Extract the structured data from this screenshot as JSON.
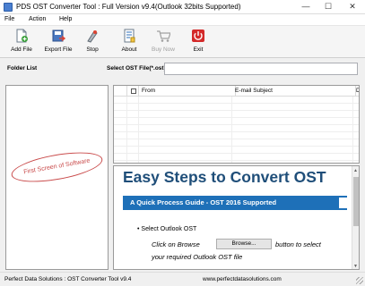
{
  "window": {
    "title": "PDS OST Converter Tool : Full Version v9.4(Outlook 32bits Supported)",
    "minimize_glyph": "—",
    "maximize_glyph": "☐",
    "close_glyph": "✕"
  },
  "menu": {
    "items": [
      "File",
      "Action",
      "Help"
    ]
  },
  "toolbar": {
    "buttons": [
      {
        "label": "Add File",
        "icon": "add-file-icon",
        "enabled": true
      },
      {
        "label": "Export File",
        "icon": "export-file-icon",
        "enabled": true
      },
      {
        "label": "Stop",
        "icon": "stop-icon",
        "enabled": true
      },
      {
        "label": "About",
        "icon": "about-icon",
        "enabled": true
      },
      {
        "label": "Buy Now",
        "icon": "cart-icon",
        "enabled": false
      },
      {
        "label": "Exit",
        "icon": "power-icon",
        "enabled": true
      }
    ]
  },
  "labels": {
    "folder_list": "Folder List",
    "select_ost": "Select OST File(*.ost) :",
    "select_ost_value": ""
  },
  "folder_pane": {
    "stamp_text": "First Screen of Software"
  },
  "mail_grid": {
    "columns": [
      "",
      "",
      "From",
      "E-mail Subject",
      "D"
    ]
  },
  "preview": {
    "heading": "Easy Steps to Convert OST",
    "band_text": "A Quick Process Guide - OST 2016 Supported",
    "bullet": "Select Outlook OST",
    "line1_prefix": "Click on Browse",
    "browse_label": "Browse...",
    "line1_suffix": "button to select",
    "line2": "your required Outlook OST file"
  },
  "status": {
    "left": "Perfect Data Solutions : OST Converter Tool v9.4",
    "url": "www.perfectdatasolutions.com"
  },
  "colors": {
    "accent_blue": "#1e70b8",
    "heading_blue": "#1f4e79",
    "stamp_red": "#c94a4a"
  }
}
